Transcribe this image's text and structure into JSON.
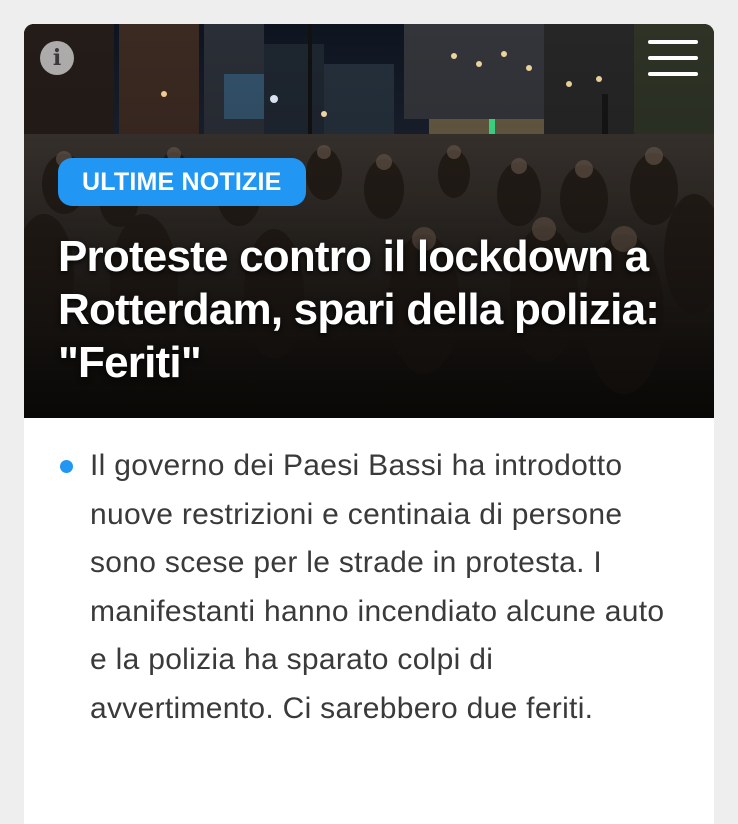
{
  "article": {
    "badge_label": "ULTIME NOTIZIE",
    "headline": "Proteste contro il lockdown a Rotterdam, spari della polizia: \"Feriti\"",
    "summary": "Il governo dei Paesi Bassi ha introdotto nuove restrizioni e centinaia di persone sono scese per le strade in protesta. I manifestanti hanno incendiato alcune auto e la polizia ha sparato colpi di avvertimento. Ci sarebbero due feriti."
  },
  "controls": {
    "info_icon_glyph": "i",
    "info_icon": "info-icon",
    "menu_icon": "hamburger-menu-icon"
  },
  "colors": {
    "accent": "#2196f3",
    "page_background": "#eeeeee",
    "card_background": "#ffffff",
    "body_text": "#3a3a3a",
    "headline_text": "#ffffff"
  }
}
